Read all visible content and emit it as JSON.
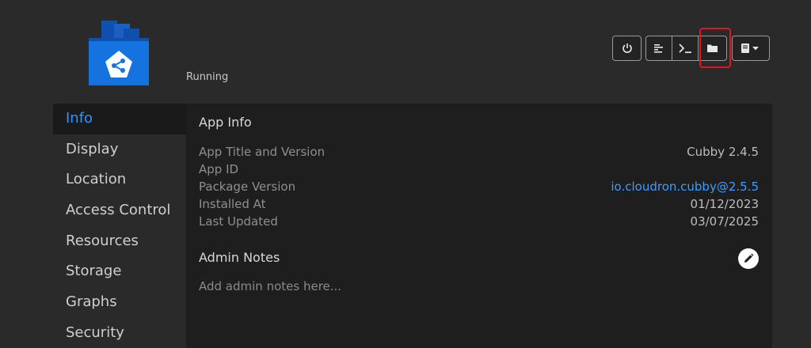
{
  "app": {
    "status": "Running",
    "logo_icon": "cubby-share-folder-icon",
    "logo_colors": {
      "primary": "#1573e0",
      "dark": "#0f4fb0",
      "light": "#ffffff"
    }
  },
  "toolbar": {
    "buttons": [
      {
        "icon": "power-icon"
      },
      {
        "icon": "logs-icon"
      },
      {
        "icon": "terminal-icon"
      },
      {
        "icon": "folder-icon"
      },
      {
        "icon": "book-dropdown-icon"
      }
    ],
    "highlight_color": "#e3151a"
  },
  "sidebar": {
    "items": [
      {
        "label": "Info",
        "active": true
      },
      {
        "label": "Display"
      },
      {
        "label": "Location"
      },
      {
        "label": "Access Control"
      },
      {
        "label": "Resources"
      },
      {
        "label": "Storage"
      },
      {
        "label": "Graphs"
      },
      {
        "label": "Security"
      }
    ],
    "active_color": "#2f95ff"
  },
  "info": {
    "title": "App Info",
    "rows": [
      {
        "label": "App Title and Version",
        "value": "Cubby 2.4.5"
      },
      {
        "label": "App ID",
        "value": ""
      },
      {
        "label": "Package Version",
        "value": "io.cloudron.cubby@2.5.5"
      },
      {
        "label": "Installed At",
        "value": "01/12/2023"
      },
      {
        "label": "Last Updated",
        "value": "03/07/2025"
      }
    ],
    "link_color": "#3d9cff"
  },
  "notes": {
    "title": "Admin Notes",
    "placeholder": "Add admin notes here...",
    "edit_icon": "pencil-icon"
  }
}
